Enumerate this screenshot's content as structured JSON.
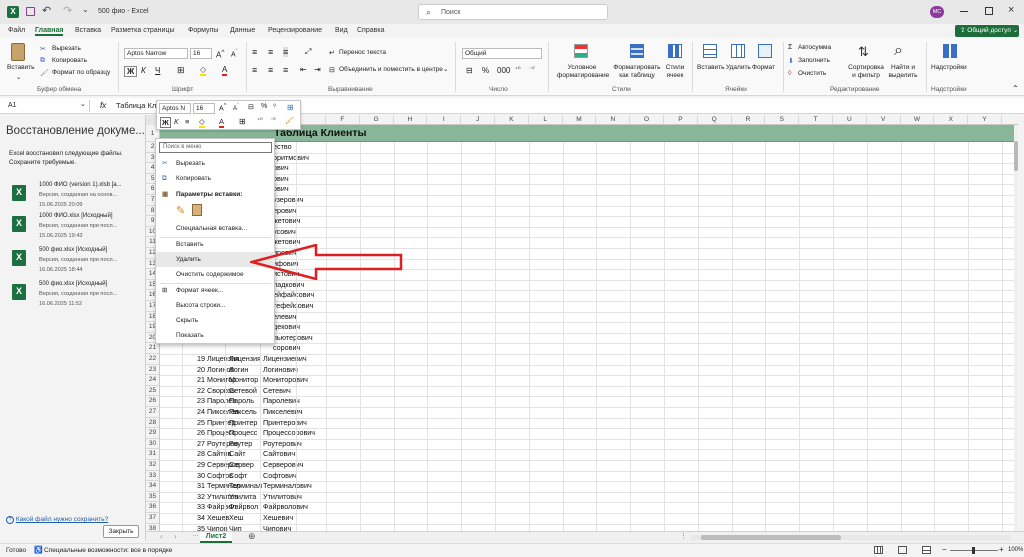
{
  "title_bar": {
    "file_name": "500 фио",
    "app_name": "Excel",
    "search_placeholder": "Поиск",
    "avatar_initials": "MC"
  },
  "menu": {
    "tabs": [
      "Файл",
      "Главная",
      "Вставка",
      "Разметка страницы",
      "Формулы",
      "Данные",
      "Рецензирование",
      "Вид",
      "Справка"
    ],
    "active_tab": "Главная",
    "share_label": "Общий доступ"
  },
  "ribbon": {
    "clipboard": {
      "paste": "Вставить",
      "cut": "Вырезать",
      "copy": "Копировать",
      "format_painter": "Формат по образцу",
      "group": "Буфер обмена"
    },
    "font": {
      "name": "Aptos Narrow",
      "size": "16",
      "bold": "Ж",
      "italic": "К",
      "underline": "Ч",
      "group": "Шрифт"
    },
    "alignment": {
      "wrap": "Перенос текста",
      "merge": "Объединить и поместить в центре",
      "group": "Выравнивание"
    },
    "number": {
      "format": "Общий",
      "group": "Число"
    },
    "styles": {
      "conditional": "Условное форматирование",
      "as_table": "Форматировать как таблицу",
      "cell_styles": "Стили ячеек",
      "group": "Стили"
    },
    "cells": {
      "insert": "Вставить",
      "delete": "Удалить",
      "format": "Формат",
      "group": "Ячейки"
    },
    "editing": {
      "autosum": "Автосумма",
      "fill": "Заполнить",
      "clear": "Очистить",
      "sort": "Сортировка и фильтр",
      "find": "Найти и выделить",
      "group": "Редактирование"
    },
    "addins": {
      "label": "Надстройки",
      "group": "Надстройки"
    }
  },
  "formula_bar": {
    "cell_ref": "A1",
    "fx": "fx",
    "content": "Таблица Кл"
  },
  "mini_toolbar": {
    "font": "Aptos N",
    "size": "16",
    "bold": "Ж",
    "italic": "К"
  },
  "recovery": {
    "title": "Восстановление докуме...",
    "desc": "Excel восстановил следующие файлы. Сохраните требуемые.",
    "files": [
      {
        "name": "1000 ФИО (version 1).xlsb  [а...",
        "desc": "Версия, созданная на основ...",
        "date": "15.06.2025 20:09"
      },
      {
        "name": "1000 ФИО.xlsx  [Исходный]",
        "desc": "Версия, созданная при посл...",
        "date": "15.06.2025 19:43"
      },
      {
        "name": "500 фио.xlsx  [Исходный]",
        "desc": "Версия, созданная при посл...",
        "date": "16.06.2025 18:44"
      },
      {
        "name": "500 фио.xlsx  [Исходный]",
        "desc": "Версия, созданная при посл...",
        "date": "16.06.2025 11:52"
      }
    ],
    "help_link": "Какой файл нужно сохранить?",
    "close_button": "Закрыть"
  },
  "grid": {
    "columns": [
      "F",
      "G",
      "H",
      "I",
      "J",
      "K",
      "L",
      "M",
      "N",
      "O",
      "P",
      "Q",
      "R",
      "S",
      "T",
      "U",
      "V",
      "W",
      "X",
      "Y"
    ],
    "header_title": "Таблица Клиенты",
    "partial_rows": [
      {
        "row": "2",
        "c": "ество"
      },
      {
        "row": "3",
        "c": "оритмович"
      },
      {
        "row": "4",
        "c": "ович"
      },
      {
        "row": "5",
        "c": "ович"
      },
      {
        "row": "6",
        "c": "ович"
      },
      {
        "row": "7",
        "c": "узерович"
      },
      {
        "row": "8",
        "c": "ерович"
      },
      {
        "row": "9",
        "c": "жетович"
      },
      {
        "row": "10",
        "c": "усович"
      },
      {
        "row": "11",
        "c": "жетович"
      },
      {
        "row": "12",
        "c": "ирович"
      },
      {
        "row": "13",
        "c": "ифович"
      },
      {
        "row": "14",
        "c": "истович"
      },
      {
        "row": "15",
        "c": "ладкович"
      },
      {
        "row": "16",
        "c": "ейфайсович"
      },
      {
        "row": "17",
        "c": "тефейсович"
      },
      {
        "row": "18",
        "c": "елевич"
      },
      {
        "row": "19",
        "c": "декович"
      },
      {
        "row": "20",
        "c": "пьютерович"
      },
      {
        "row": "21",
        "c": "сорович"
      }
    ],
    "rows": [
      {
        "row": "22",
        "n": "19",
        "a": "Лицензия",
        "b": "Лицензия",
        "c": "Лицензиевич"
      },
      {
        "row": "23",
        "n": "20",
        "a": "Логинов",
        "b": "Логин",
        "c": "Логинович"
      },
      {
        "row": "24",
        "n": "21",
        "a": "Монитор",
        "b": "Монитор",
        "c": "Мониторович"
      },
      {
        "row": "25",
        "n": "22",
        "a": "Сворков",
        "b": "Сетевой",
        "c": "Сетевич"
      },
      {
        "row": "26",
        "n": "23",
        "a": "Паролев",
        "b": "Пароль",
        "c": "Паролевич"
      },
      {
        "row": "27",
        "n": "24",
        "a": "Пикселев",
        "b": "Пиксель",
        "c": "Пикселевич"
      },
      {
        "row": "28",
        "n": "25",
        "a": "Принтер",
        "b": "Принтер",
        "c": "Принтерович"
      },
      {
        "row": "29",
        "n": "26",
        "a": "Процесс",
        "b": "Процесс",
        "c": "Процессорович"
      },
      {
        "row": "30",
        "n": "27",
        "a": "Роутеров",
        "b": "Роутер",
        "c": "Роутерович"
      },
      {
        "row": "31",
        "n": "28",
        "a": "Сайтов",
        "b": "Сайт",
        "c": "Сайтович"
      },
      {
        "row": "32",
        "n": "29",
        "a": "Серверов",
        "b": "Сервер",
        "c": "Серверович"
      },
      {
        "row": "33",
        "n": "30",
        "a": "Софтов",
        "b": "Софт",
        "c": "Софтович"
      },
      {
        "row": "34",
        "n": "31",
        "a": "Терминал",
        "b": "Терминал",
        "c": "Терминалович"
      },
      {
        "row": "35",
        "n": "32",
        "a": "Утилитов",
        "b": "Утилита",
        "c": "Утилитович"
      },
      {
        "row": "36",
        "n": "33",
        "a": "Файрвол",
        "b": "Файрвол",
        "c": "Файрволович"
      },
      {
        "row": "37",
        "n": "34",
        "a": "Хешев",
        "b": "Хеш",
        "c": "Хешевич"
      },
      {
        "row": "38",
        "n": "35",
        "a": "Чипов",
        "b": "Чип",
        "c": "Чипович"
      }
    ]
  },
  "context_menu": {
    "search_placeholder": "Поиск в меню",
    "cut": "Вырезать",
    "copy": "Копировать",
    "paste_options": "Параметры вставки:",
    "paste_special": "Специальная вставка...",
    "insert": "Вставить",
    "delete": "Удалить",
    "clear": "Очистить содержимое",
    "format_cells": "Формат ячеек...",
    "row_height": "Высота строки...",
    "hide": "Скрыть",
    "show": "Показать"
  },
  "sheet_tabs": {
    "active": "Лист2"
  },
  "status": {
    "ready": "Готово",
    "accessibility": "Специальные возможности: все в порядке",
    "zoom": "100%"
  },
  "colors": {
    "excel_green": "#1d6f42",
    "header_green": "#87b798",
    "arrow_red": "#e02020"
  }
}
